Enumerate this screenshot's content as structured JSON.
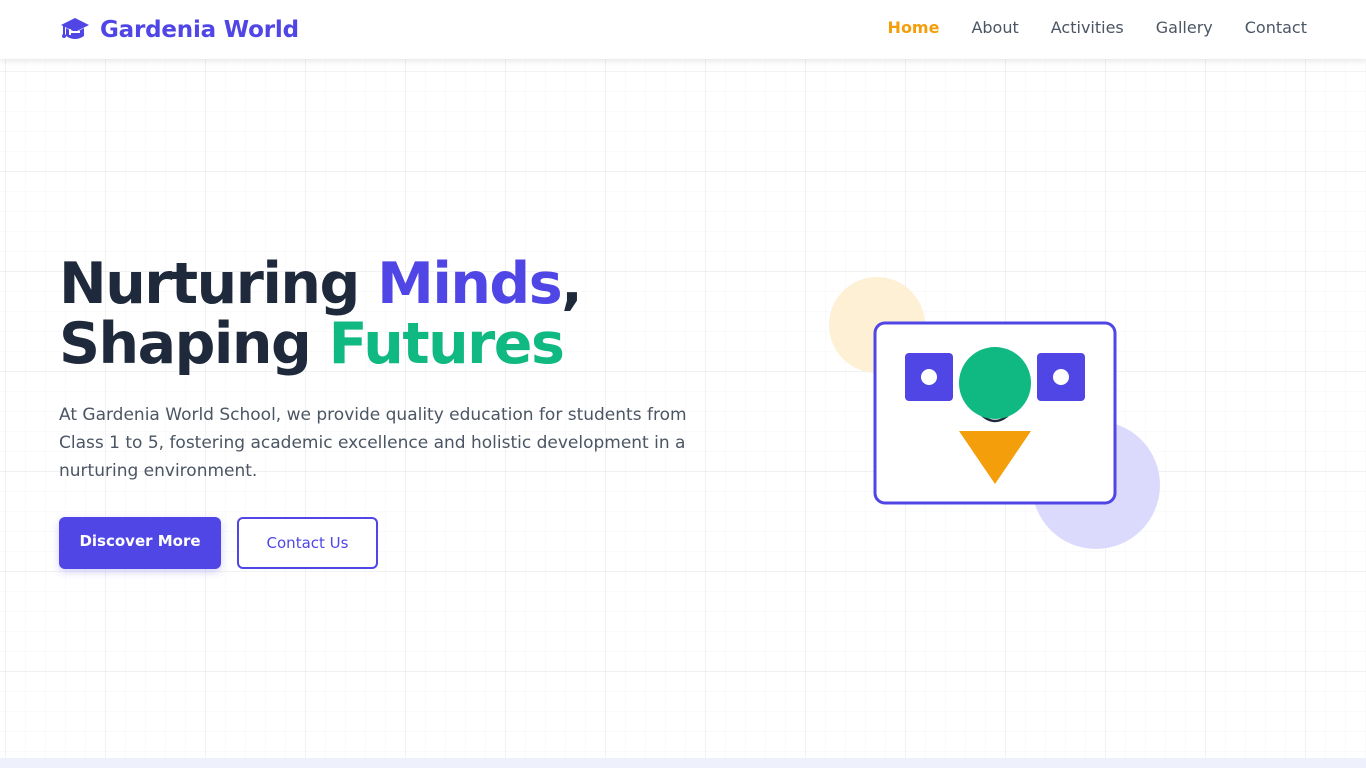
{
  "brand": {
    "name": "Gardenia World",
    "icon": "graduation-cap-icon",
    "color": "#4f46e5"
  },
  "nav": {
    "items": [
      {
        "label": "Home",
        "active": true
      },
      {
        "label": "About",
        "active": false
      },
      {
        "label": "Activities",
        "active": false
      },
      {
        "label": "Gallery",
        "active": false
      },
      {
        "label": "Contact",
        "active": false
      }
    ],
    "active_color": "#f59e0b"
  },
  "hero": {
    "title_line1_part1": "Nurturing ",
    "title_line1_highlight": "Minds",
    "title_line1_part2": ",",
    "title_line2_part1": "Shaping ",
    "title_line2_highlight": "Futures",
    "description": "At Gardenia World School, we provide quality education for students from Class 1 to 5, fostering academic excellence and holistic development in a nurturing environment.",
    "primary_button": "Discover More",
    "secondary_button": "Contact Us"
  },
  "colors": {
    "primary": "#4f46e5",
    "green": "#10b981",
    "amber": "#f59e0b",
    "heading": "#1e293b",
    "text": "#4b5563"
  }
}
